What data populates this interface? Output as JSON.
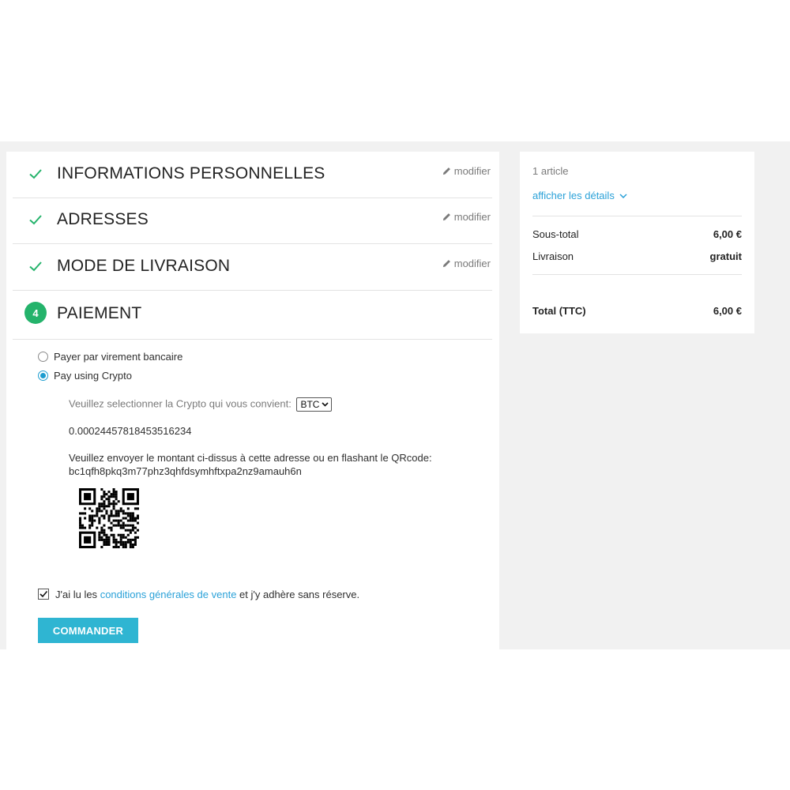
{
  "steps": [
    {
      "title": "Informations personnelles",
      "edit_label": "modifier",
      "done": true
    },
    {
      "title": "Adresses",
      "edit_label": "modifier",
      "done": true
    },
    {
      "title": "Mode de livraison",
      "edit_label": "modifier",
      "done": true
    },
    {
      "title": "Paiement",
      "number": "4"
    }
  ],
  "payment": {
    "options": [
      {
        "label": "Payer par virement bancaire",
        "selected": false
      },
      {
        "label": "Pay using Crypto",
        "selected": true
      }
    ],
    "crypto_prompt": "Veuillez selectionner la Crypto qui vous convient:",
    "crypto_selected": "BTC",
    "amount": "0.00024457818453516234",
    "send_instruction": "Veuillez envoyer le montant ci-dissus à cette adresse ou en flashant le QRcode:",
    "address": "bc1qfh8pkq3m77phz3qhfdsymhftxpa2nz9amauh6n",
    "terms_before": "J'ai lu les",
    "terms_link": "conditions générales de vente",
    "terms_after": "et j'y adhère sans réserve.",
    "terms_checked": true,
    "order_button": "COMMANDER"
  },
  "summary": {
    "article_count": "1 article",
    "details_link": "afficher les détails",
    "subtotal_label": "Sous-total",
    "subtotal_value": "6,00 €",
    "shipping_label": "Livraison",
    "shipping_value": "gratuit",
    "total_label": "Total (TTC)",
    "total_value": "6,00 €"
  },
  "colors": {
    "accent": "#2fb5d2",
    "link": "#2aa1d8",
    "success": "#24b36b",
    "background": "#f1f1f1"
  }
}
